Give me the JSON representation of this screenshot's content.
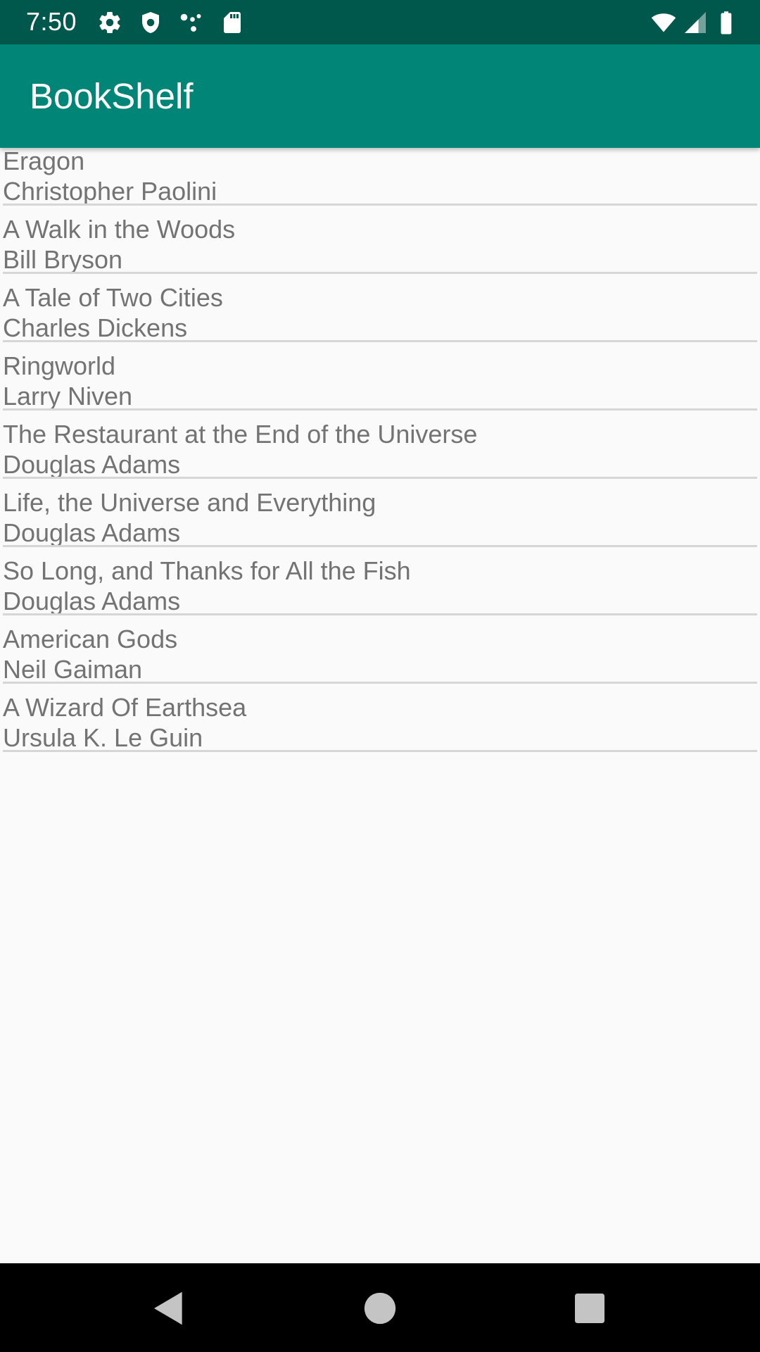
{
  "status_bar": {
    "time": "7:50",
    "left_icons": [
      "gear-icon",
      "shield-icon",
      "network-dots-icon",
      "sd-card-icon"
    ],
    "right_icons": [
      "wifi-icon",
      "cell-signal-icon",
      "battery-icon"
    ]
  },
  "app_bar": {
    "title": "BookShelf"
  },
  "books": [
    {
      "title": "Eragon",
      "author": "Christopher Paolini"
    },
    {
      "title": "A Walk in the Woods",
      "author": "Bill Bryson"
    },
    {
      "title": "A Tale of Two Cities",
      "author": "Charles Dickens"
    },
    {
      "title": "Ringworld",
      "author": "Larry Niven"
    },
    {
      "title": "The Restaurant at the End of the Universe",
      "author": "Douglas Adams"
    },
    {
      "title": "Life, the Universe and Everything",
      "author": "Douglas Adams"
    },
    {
      "title": "So Long, and Thanks for All the Fish",
      "author": "Douglas Adams"
    },
    {
      "title": "American Gods",
      "author": "Neil Gaiman"
    },
    {
      "title": "A Wizard Of Earthsea",
      "author": "Ursula K. Le Guin"
    }
  ],
  "nav_bar": {
    "buttons": [
      "back-icon",
      "home-icon",
      "recents-icon"
    ]
  },
  "colors": {
    "status_bar": "#00574b",
    "app_bar": "#008577",
    "background": "#fafafa",
    "list_text": "#737373",
    "divider": "#d6d6d6",
    "nav_bar": "#000000"
  }
}
